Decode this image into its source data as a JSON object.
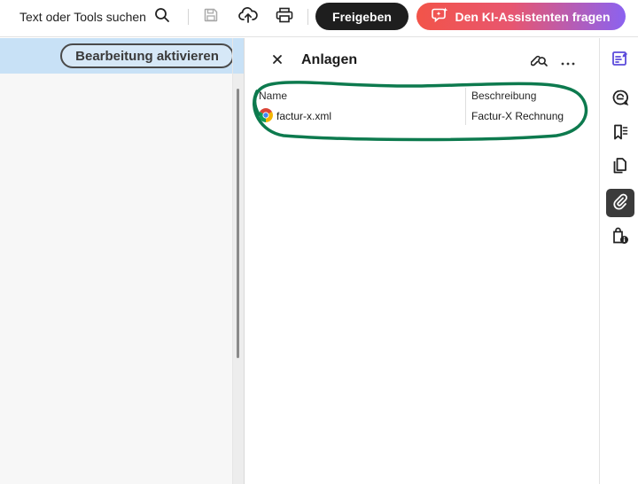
{
  "toolbar": {
    "search_label": "Text oder Tools suchen",
    "share_label": "Freigeben",
    "ai_label": "Den KI-Assistenten fragen",
    "icons": [
      "search-icon",
      "save-icon",
      "upload-cloud-icon",
      "print-icon",
      "ai-assistant-icon"
    ]
  },
  "document": {
    "edit_button_label": "Bearbeitung aktivieren"
  },
  "panel": {
    "title": "Anlagen",
    "columns": {
      "name": "Name",
      "description": "Beschreibung"
    },
    "attachments": [
      {
        "name": "factur-x.xml",
        "description": "Factur-X Rechnung",
        "icon": "chrome-file-icon"
      }
    ]
  },
  "rail": {
    "items": [
      {
        "icon": "edit-pdf-icon",
        "active": false
      },
      {
        "icon": "comment-icon",
        "active": false
      },
      {
        "icon": "bookmark-icon",
        "active": false
      },
      {
        "icon": "pages-icon",
        "active": false
      },
      {
        "icon": "attachment-icon",
        "active": true
      },
      {
        "icon": "security-icon",
        "active": false
      }
    ]
  },
  "colors": {
    "accent_blue_banner": "#c8e1f6",
    "annotation_green": "#0d7a4e",
    "share_button": "#1e1e1e",
    "ai_gradient_start": "#f25449",
    "ai_gradient_end": "#8b62f0",
    "rail_icon_purple": "#5b4bdb"
  }
}
